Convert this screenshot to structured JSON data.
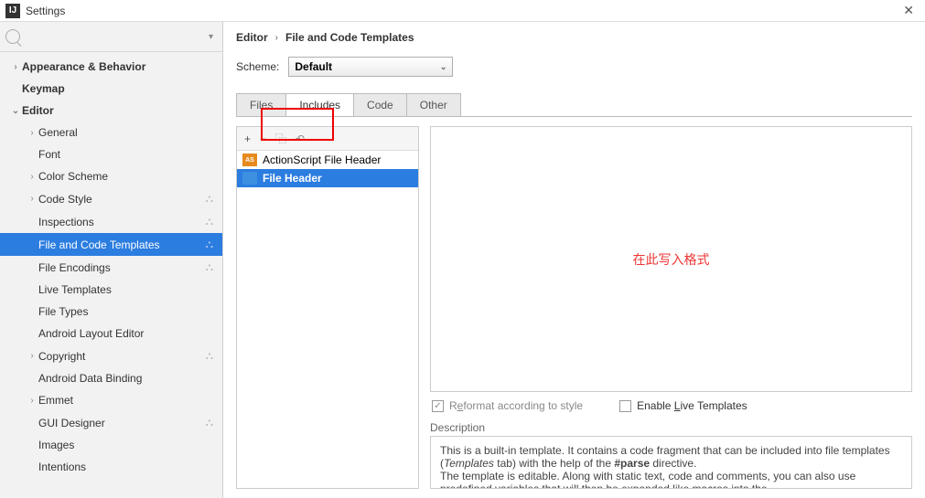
{
  "window": {
    "title": "Settings",
    "close_glyph": "✕"
  },
  "search": {
    "placeholder": "",
    "dropdown_glyph": "▾"
  },
  "sidebar": {
    "items": [
      {
        "label": "Appearance & Behavior",
        "level": 1,
        "arrow": "›",
        "bold": true,
        "selected": false,
        "cog": false
      },
      {
        "label": "Keymap",
        "level": 1,
        "arrow": "",
        "bold": true,
        "selected": false,
        "cog": false
      },
      {
        "label": "Editor",
        "level": 1,
        "arrow": "⌄",
        "bold": true,
        "selected": false,
        "cog": false
      },
      {
        "label": "General",
        "level": 2,
        "arrow": "›",
        "bold": false,
        "selected": false,
        "cog": false
      },
      {
        "label": "Font",
        "level": 2,
        "arrow": "",
        "bold": false,
        "selected": false,
        "cog": false
      },
      {
        "label": "Color Scheme",
        "level": 2,
        "arrow": "›",
        "bold": false,
        "selected": false,
        "cog": false
      },
      {
        "label": "Code Style",
        "level": 2,
        "arrow": "›",
        "bold": false,
        "selected": false,
        "cog": true
      },
      {
        "label": "Inspections",
        "level": 2,
        "arrow": "",
        "bold": false,
        "selected": false,
        "cog": true
      },
      {
        "label": "File and Code Templates",
        "level": 2,
        "arrow": "",
        "bold": false,
        "selected": true,
        "cog": true
      },
      {
        "label": "File Encodings",
        "level": 2,
        "arrow": "",
        "bold": false,
        "selected": false,
        "cog": true
      },
      {
        "label": "Live Templates",
        "level": 2,
        "arrow": "",
        "bold": false,
        "selected": false,
        "cog": false
      },
      {
        "label": "File Types",
        "level": 2,
        "arrow": "",
        "bold": false,
        "selected": false,
        "cog": false
      },
      {
        "label": "Android Layout Editor",
        "level": 2,
        "arrow": "",
        "bold": false,
        "selected": false,
        "cog": false
      },
      {
        "label": "Copyright",
        "level": 2,
        "arrow": "›",
        "bold": false,
        "selected": false,
        "cog": true
      },
      {
        "label": "Android Data Binding",
        "level": 2,
        "arrow": "",
        "bold": false,
        "selected": false,
        "cog": false
      },
      {
        "label": "Emmet",
        "level": 2,
        "arrow": "›",
        "bold": false,
        "selected": false,
        "cog": false
      },
      {
        "label": "GUI Designer",
        "level": 2,
        "arrow": "",
        "bold": false,
        "selected": false,
        "cog": true
      },
      {
        "label": "Images",
        "level": 2,
        "arrow": "",
        "bold": false,
        "selected": false,
        "cog": false
      },
      {
        "label": "Intentions",
        "level": 2,
        "arrow": "",
        "bold": false,
        "selected": false,
        "cog": false
      }
    ]
  },
  "breadcrumb": {
    "part1": "Editor",
    "sep": "›",
    "part2": "File and Code Templates"
  },
  "scheme": {
    "label": "Scheme:",
    "value": "Default",
    "chev": "⌄"
  },
  "tabs": [
    {
      "label": "Files",
      "active": false
    },
    {
      "label": "Includes",
      "active": true
    },
    {
      "label": "Code",
      "active": false
    },
    {
      "label": "Other",
      "active": false
    }
  ],
  "toolbar": {
    "add": "+",
    "remove": "−",
    "copy": "⿻",
    "undo": "↶"
  },
  "file_list": [
    {
      "label": "ActionScript File Header",
      "icon": "AS",
      "iconClass": "orange",
      "selected": false
    },
    {
      "label": "File Header",
      "icon": "",
      "iconClass": "blue",
      "selected": true
    }
  ],
  "editor": {
    "placeholder": "在此写入格式"
  },
  "options": {
    "reformat_label_pre": "R",
    "reformat_label_u": "e",
    "reformat_label_post": "format according to style",
    "reformat_checked": true,
    "enable_live_label_pre": "Enable ",
    "enable_live_label_u": "L",
    "enable_live_label_post": "ive Templates",
    "enable_live_checked": false
  },
  "description": {
    "label": "Description",
    "l1a": "This is a built-in template. It contains a code fragment that can be included into file templates (",
    "l1b": "Templates",
    "l1c": " tab) with the help of the ",
    "l1d": "#parse",
    "l1e": " directive.",
    "l2": "The template is editable. Along with static text, code and comments, you can also use predefined variables that will then be expanded like macros into the"
  },
  "watermark": ""
}
